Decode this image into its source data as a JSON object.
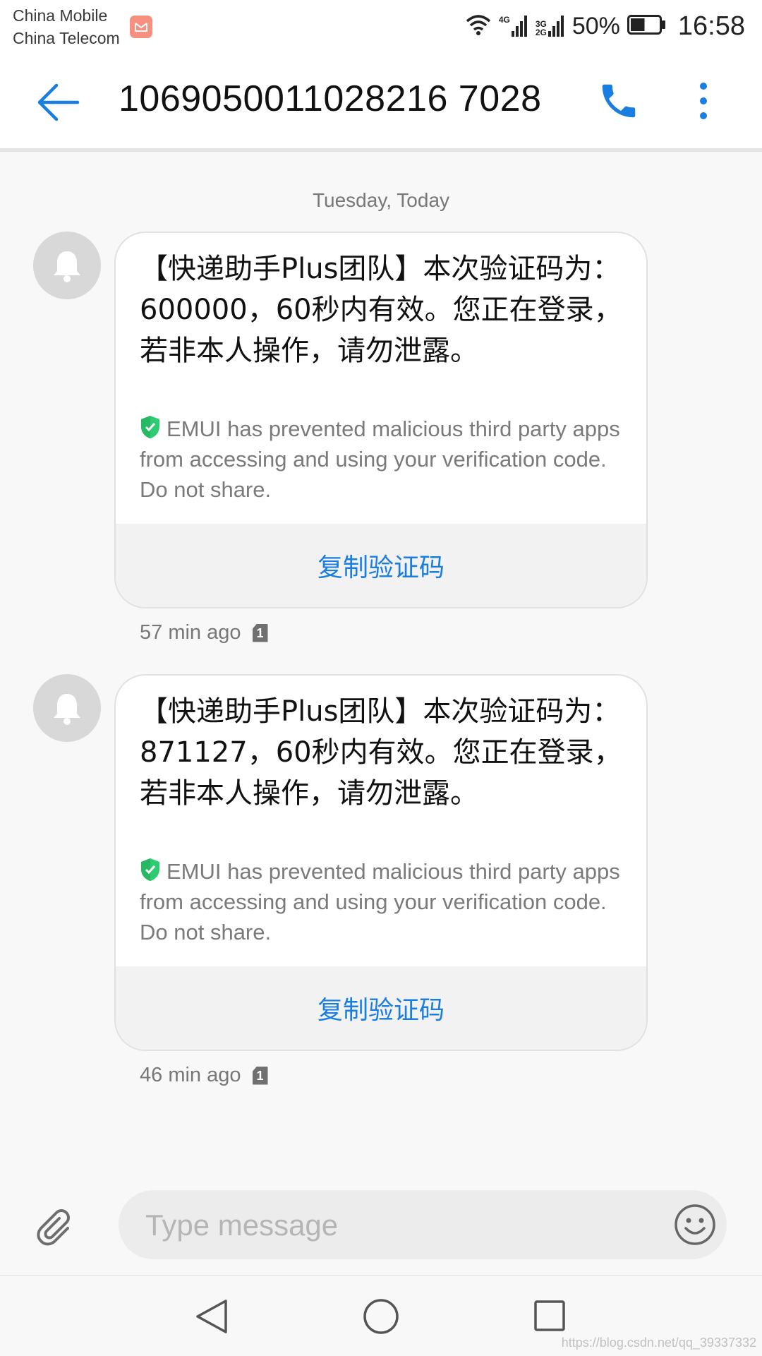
{
  "status_bar": {
    "carrier_1": "China Mobile",
    "carrier_2": "China Telecom",
    "network_1": "4G",
    "network_2_top": "3G",
    "network_2_bottom": "2G",
    "battery": "50%",
    "time": "16:58",
    "battery_level": 0.5
  },
  "header": {
    "title": "1069050011028216 7028",
    "back_icon": "arrow-left-icon",
    "call_icon": "phone-icon",
    "more_icon": "more-vertical-icon"
  },
  "conversation": {
    "date_separator": "Tuesday, Today",
    "messages": [
      {
        "text": "【快递助手Plus团队】本次验证码为：600000，60秒内有效。您正在登录，若非本人操作，请勿泄露。",
        "emui_notice": "EMUI has prevented malicious third party apps from accessing and using your verification code. Do not share.",
        "copy_label": "复制验证码",
        "time": "57 min ago",
        "sim": "1"
      },
      {
        "text": "【快递助手Plus团队】本次验证码为：871127，60秒内有效。您正在登录，若非本人操作，请勿泄露。",
        "emui_notice": "EMUI has prevented malicious third party apps from accessing and using your verification code. Do not share.",
        "copy_label": "复制验证码",
        "time": "46 min ago",
        "sim": "1"
      }
    ]
  },
  "composer": {
    "placeholder": "Type message",
    "value": ""
  },
  "watermark": "https://blog.csdn.net/qq_39337332",
  "colors": {
    "accent": "#1a7de0",
    "shield": "#2ecc71",
    "avatar": "#d8d8d8"
  }
}
